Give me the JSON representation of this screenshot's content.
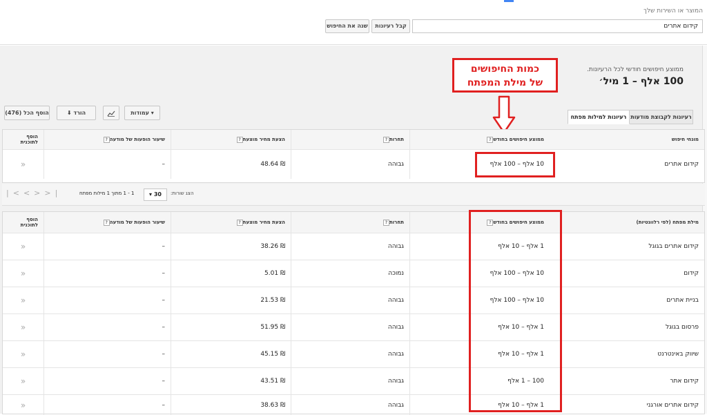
{
  "header": {
    "product_label": "המוצר או השירות שלך",
    "product_value": "קידום אתרים",
    "get_ideas_button": "קבל רעיונות",
    "modify_search_button": "שנה את החיפוש"
  },
  "summary": {
    "label": "ממוצע חיפושים חודשי לכל הרעיונות.",
    "value": "100 אלף – 1 מיל׳"
  },
  "callout": {
    "line1": "כמות החיפושים",
    "line2": "של מילת המפתח"
  },
  "tabs": [
    {
      "label": "רעיונות לקבוצת מודעות"
    },
    {
      "label": "רעיונות למילות מפתח"
    }
  ],
  "toolbar": {
    "columns_label": "עמודות",
    "download_label": "הורד",
    "add_all_label": "הוסף הכל (476)"
  },
  "columns": {
    "search_term": "מונחי חיפוש",
    "keyword_by_relevance": "מילת מפתח (לפי רלוונטיות)",
    "avg_monthly": "ממוצע חיפושים בחודש",
    "competition": "תחרות",
    "suggested_bid": "הצעת מחיר מוצעת",
    "ad_impr_share": "שיעור הופעות של מודעה",
    "add_to_plan": "הוסף לתוכנית"
  },
  "search_term_row": {
    "keyword": "קידום אתרים",
    "avg": "10 אלף – 100 אלף",
    "competition": "גבוהה",
    "bid": "₪ 48.64",
    "share": "–"
  },
  "pager": {
    "show_rows_label": "הצג שורות:",
    "rows_value": "30",
    "range_text": "1 - 1 מתוך 1 מילות מפתח"
  },
  "keywords": [
    {
      "keyword": "קידום אתרים בגוגל",
      "avg": "1 אלף – 10 אלף",
      "competition": "גבוהה",
      "bid": "₪ 38.26",
      "share": "–"
    },
    {
      "keyword": "קידום",
      "avg": "10 אלף – 100 אלף",
      "competition": "נמוכה",
      "bid": "₪ 5.01",
      "share": "–"
    },
    {
      "keyword": "בניית אתרים",
      "avg": "10 אלף – 100 אלף",
      "competition": "גבוהה",
      "bid": "₪ 21.53",
      "share": "–"
    },
    {
      "keyword": "פרסום בגוגל",
      "avg": "1 אלף – 10 אלף",
      "competition": "גבוהה",
      "bid": "₪ 51.95",
      "share": "–"
    },
    {
      "keyword": "שיווק באינטרנט",
      "avg": "1 אלף – 10 אלף",
      "competition": "גבוהה",
      "bid": "₪ 45.15",
      "share": "–"
    },
    {
      "keyword": "קידום אתר",
      "avg": "100 – 1 אלף",
      "competition": "גבוהה",
      "bid": "₪ 43.51",
      "share": "–"
    },
    {
      "keyword": "קידום אתרים אורגני",
      "avg": "1 אלף – 10 אלף",
      "competition": "גבוהה",
      "bid": "₪ 38.63",
      "share": "–"
    }
  ],
  "colors": {
    "accent": "#e02020",
    "brand_blue": "#4285f4"
  }
}
